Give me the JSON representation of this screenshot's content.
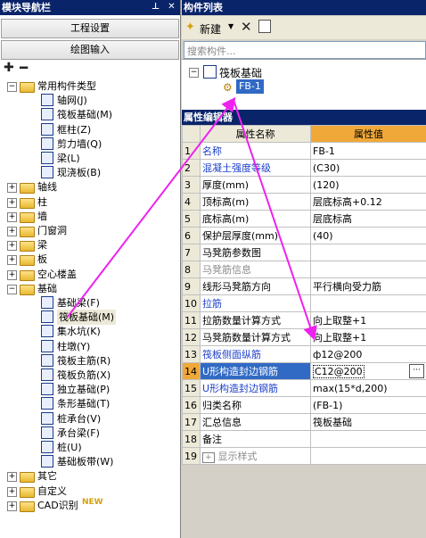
{
  "left_panel": {
    "title": "模块导航栏",
    "pin_icon": "pin-icon",
    "close_icon": "close-icon",
    "btn_project": "工程设置",
    "btn_drawing": "绘图输入",
    "tree": [
      {
        "label": "常用构件类型",
        "level": 0,
        "kind": "folder",
        "state": "open"
      },
      {
        "label": "轴网(J)",
        "level": 1,
        "kind": "item",
        "icon": "axis-grid-icon"
      },
      {
        "label": "筏板基础(M)",
        "level": 1,
        "kind": "item",
        "icon": "raft-foundation-icon"
      },
      {
        "label": "框柱(Z)",
        "level": 1,
        "kind": "item",
        "icon": "frame-column-icon"
      },
      {
        "label": "剪力墙(Q)",
        "level": 1,
        "kind": "item",
        "icon": "shear-wall-icon"
      },
      {
        "label": "梁(L)",
        "level": 1,
        "kind": "item",
        "icon": "beam-icon"
      },
      {
        "label": "现浇板(B)",
        "level": 1,
        "kind": "item",
        "icon": "slab-icon"
      },
      {
        "label": "轴线",
        "level": 0,
        "kind": "folder",
        "state": "closed"
      },
      {
        "label": "柱",
        "level": 0,
        "kind": "folder",
        "state": "closed"
      },
      {
        "label": "墙",
        "level": 0,
        "kind": "folder",
        "state": "closed"
      },
      {
        "label": "门窗洞",
        "level": 0,
        "kind": "folder",
        "state": "closed"
      },
      {
        "label": "梁",
        "level": 0,
        "kind": "folder",
        "state": "closed"
      },
      {
        "label": "板",
        "level": 0,
        "kind": "folder",
        "state": "closed"
      },
      {
        "label": "空心楼盖",
        "level": 0,
        "kind": "folder",
        "state": "closed"
      },
      {
        "label": "基础",
        "level": 0,
        "kind": "folder",
        "state": "open"
      },
      {
        "label": "基础梁(F)",
        "level": 1,
        "kind": "item",
        "icon": "foundation-beam-icon"
      },
      {
        "label": "筏板基础(M)",
        "level": 1,
        "kind": "item",
        "icon": "raft-foundation-icon",
        "selected": true
      },
      {
        "label": "集水坑(K)",
        "level": 1,
        "kind": "item",
        "icon": "sump-pit-icon"
      },
      {
        "label": "柱墩(Y)",
        "level": 1,
        "kind": "item",
        "icon": "column-pier-icon"
      },
      {
        "label": "筏板主筋(R)",
        "level": 1,
        "kind": "item",
        "icon": "raft-main-rebar-icon"
      },
      {
        "label": "筏板负筋(X)",
        "level": 1,
        "kind": "item",
        "icon": "raft-negative-rebar-icon"
      },
      {
        "label": "独立基础(P)",
        "level": 1,
        "kind": "item",
        "icon": "isolated-footing-icon"
      },
      {
        "label": "条形基础(T)",
        "level": 1,
        "kind": "item",
        "icon": "strip-footing-icon"
      },
      {
        "label": "桩承台(V)",
        "level": 1,
        "kind": "item",
        "icon": "pile-cap-icon"
      },
      {
        "label": "承台梁(F)",
        "level": 1,
        "kind": "item",
        "icon": "cap-beam-icon"
      },
      {
        "label": "桩(U)",
        "level": 1,
        "kind": "item",
        "icon": "pile-icon"
      },
      {
        "label": "基础板带(W)",
        "level": 1,
        "kind": "item",
        "icon": "foundation-strip-icon"
      },
      {
        "label": "其它",
        "level": 0,
        "kind": "folder",
        "state": "closed"
      },
      {
        "label": "自定义",
        "level": 0,
        "kind": "folder",
        "state": "closed"
      },
      {
        "label": "CAD识别",
        "level": 0,
        "kind": "folder",
        "state": "closed",
        "badge": "NEW"
      }
    ]
  },
  "component_list": {
    "title": "构件列表",
    "new_label": "新建",
    "search_placeholder": "搜索构件...",
    "root_label": "筏板基础",
    "child_label": "FB-1"
  },
  "property_editor": {
    "title": "属性编辑器",
    "col_name": "属性名称",
    "col_value": "属性值",
    "rows": [
      {
        "n": "1",
        "name": "名称",
        "value": "FB-1",
        "style": "blue"
      },
      {
        "n": "2",
        "name": "混凝土强度等级",
        "value": "(C30)",
        "style": "blue"
      },
      {
        "n": "3",
        "name": "厚度(mm)",
        "value": "(120)",
        "style": "normal"
      },
      {
        "n": "4",
        "name": "顶标高(m)",
        "value": "层底标高+0.12",
        "style": "normal"
      },
      {
        "n": "5",
        "name": "底标高(m)",
        "value": "层底标高",
        "style": "normal"
      },
      {
        "n": "6",
        "name": "保护层厚度(mm)",
        "value": "(40)",
        "style": "normal"
      },
      {
        "n": "7",
        "name": "马凳筋参数图",
        "value": "",
        "style": "normal"
      },
      {
        "n": "8",
        "name": "马凳筋信息",
        "value": "",
        "style": "gray"
      },
      {
        "n": "9",
        "name": "线形马凳筋方向",
        "value": "平行横向受力筋",
        "style": "normal"
      },
      {
        "n": "10",
        "name": "拉筋",
        "value": "",
        "style": "blue"
      },
      {
        "n": "11",
        "name": "拉筋数量计算方式",
        "value": "向上取整+1",
        "style": "normal"
      },
      {
        "n": "12",
        "name": "马凳筋数量计算方式",
        "value": "向上取整+1",
        "style": "normal"
      },
      {
        "n": "13",
        "name": "筏板侧面纵筋",
        "value": "ф12@200",
        "style": "blue"
      },
      {
        "n": "14",
        "name": "U形构造封边钢筋",
        "value": "C12@200",
        "style": "selected"
      },
      {
        "n": "15",
        "name": "U形构造封边钢筋",
        "value": "max(15*d,200)",
        "style": "blue"
      },
      {
        "n": "16",
        "name": "归类名称",
        "value": "(FB-1)",
        "style": "normal"
      },
      {
        "n": "17",
        "name": "汇总信息",
        "value": "筏板基础",
        "style": "normal"
      },
      {
        "n": "18",
        "name": "备注",
        "value": "",
        "style": "normal"
      },
      {
        "n": "19",
        "name": "显示样式",
        "value": "",
        "style": "gray"
      }
    ]
  },
  "colors": {
    "titlebar": "#0a246a",
    "accent_arrow": "#ee22ee",
    "selected": "#316ac5",
    "header_value_bg": "#f0a838"
  }
}
